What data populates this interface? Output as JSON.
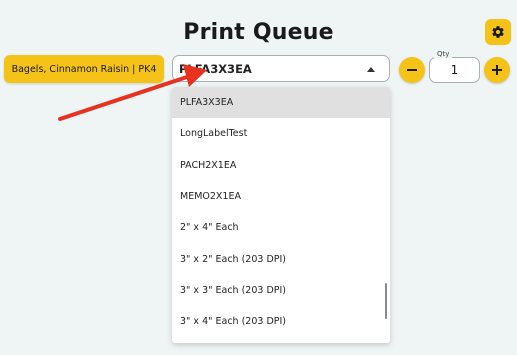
{
  "header": {
    "title": "Print Queue",
    "settings_icon": "gear-icon"
  },
  "product": {
    "label": "Bagels, Cinnamon Raisin | PK4"
  },
  "label_select": {
    "selected": "PLFA3X3EA",
    "caret_icon": "caret-up-icon",
    "options": [
      "PLFA3X3EA",
      "LongLabelTest",
      "PACH2X1EA",
      "MEMO2X1EA",
      "2\" x 4\" Each",
      "3\" x 2\" Each (203 DPI)",
      "3\" x 3\" Each (203 DPI)",
      "3\" x 4\" Each (203 DPI)"
    ]
  },
  "quantity": {
    "label": "Qty",
    "value": "1",
    "minus_icon": "minus-icon",
    "plus_icon": "plus-icon"
  },
  "colors": {
    "accent": "#f5c318",
    "background": "#eff4f5",
    "arrow": "#e8311f",
    "selected_option": "#e0e0e0"
  }
}
